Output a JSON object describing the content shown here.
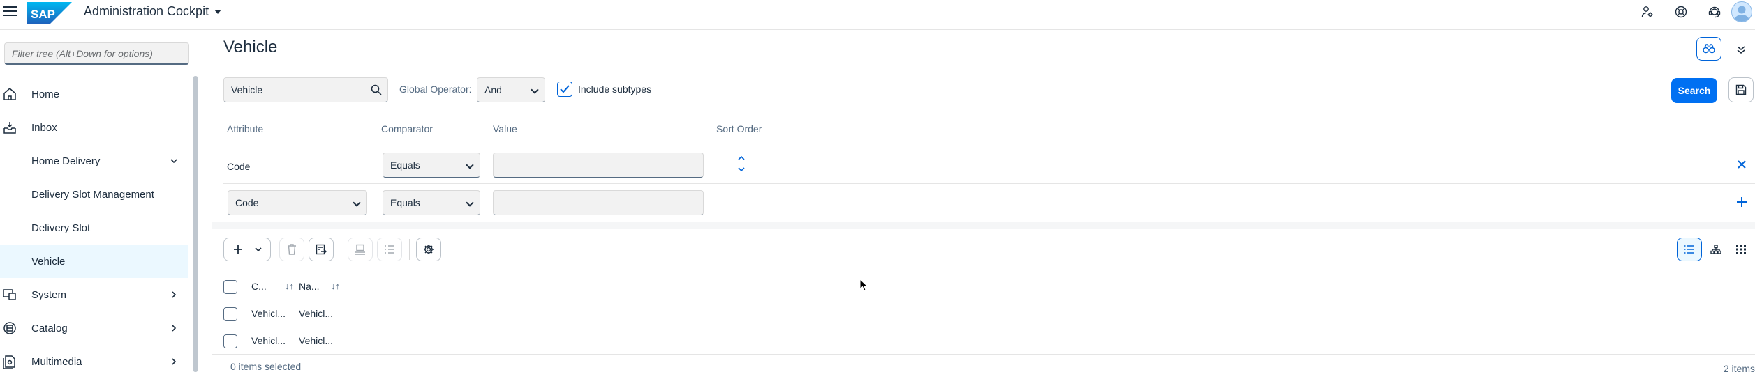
{
  "shell": {
    "app_title": "Administration Cockpit",
    "brand": "SAP",
    "icons": [
      "person-gear-icon",
      "help-icon",
      "support-icon",
      "user-avatar-icon"
    ]
  },
  "sidebar": {
    "filter_placeholder": "Filter tree (Alt+Down for options)",
    "items": [
      {
        "label": "Home",
        "icon": "home-icon"
      },
      {
        "label": "Inbox",
        "icon": "inbox-icon"
      },
      {
        "label": "Home Delivery",
        "icon": "",
        "expanded": true
      },
      {
        "label": "Delivery Slot Management"
      },
      {
        "label": "Delivery Slot"
      },
      {
        "label": "Vehicle",
        "selected": true
      },
      {
        "label": "System",
        "icon": "system-icon"
      },
      {
        "label": "Catalog",
        "icon": "catalog-icon"
      },
      {
        "label": "Multimedia",
        "icon": "multimedia-icon"
      }
    ]
  },
  "main": {
    "title": "Vehicle",
    "search": {
      "type_value": "Vehicle",
      "global_operator_label": "Global Operator:",
      "global_operator_value": "And",
      "include_subtypes_label": "Include subtypes",
      "include_subtypes_checked": true,
      "search_button": "Search"
    },
    "criteria": {
      "headers": {
        "attribute": "Attribute",
        "comparator": "Comparator",
        "value": "Value",
        "sort_order": "Sort Order"
      },
      "row1": {
        "attribute": "Code",
        "comparator": "Equals",
        "value": ""
      },
      "row2": {
        "attribute": "Code",
        "comparator": "Equals",
        "value": ""
      }
    },
    "table": {
      "columns": [
        "C...",
        "Na..."
      ],
      "rows": [
        [
          "Vehicl...",
          "Vehicl..."
        ],
        [
          "Vehicl...",
          "Vehicl..."
        ]
      ],
      "selected_count": "0 items selected",
      "total_count": "2 items"
    }
  },
  "colors": {
    "accent": "#0070f2",
    "selected_bg": "#ebf8ff",
    "text": "#1d2d3e",
    "muted": "#556b82"
  }
}
